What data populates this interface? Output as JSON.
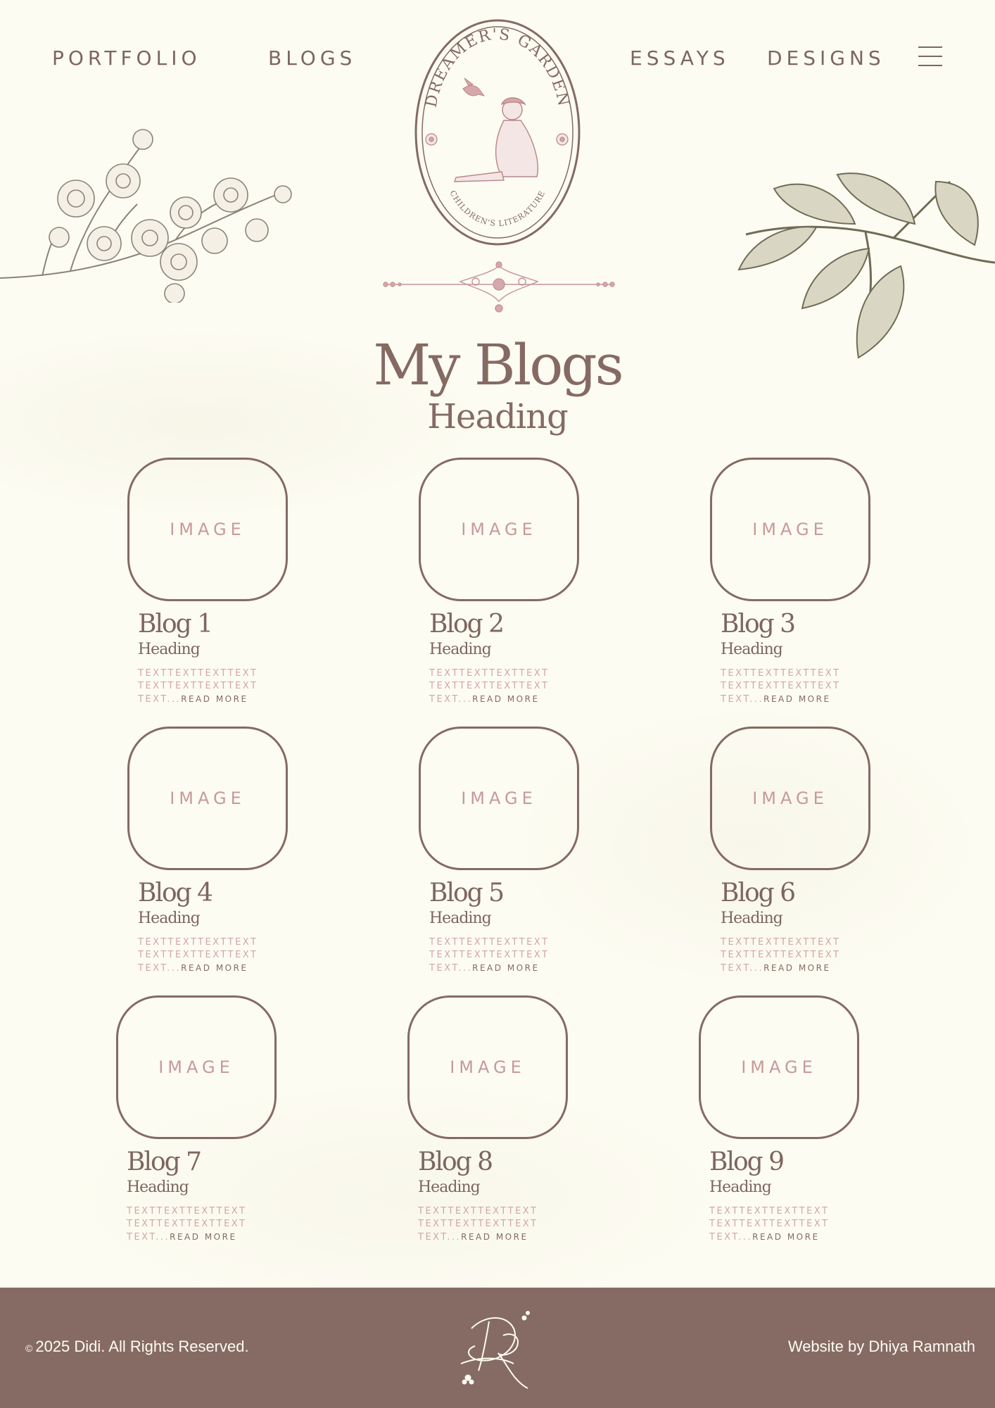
{
  "nav": {
    "portfolio": "PORTFOLIO",
    "blogs": "BLOGS",
    "essays": "ESSAYS",
    "designs": "DESIGNS",
    "menu_icon": "hamburger-menu-icon"
  },
  "logo": {
    "top_text": "DREAMER'S GARDEN",
    "bottom_text": "CHILDREN'S LITERATURE"
  },
  "page": {
    "title": "My Blogs",
    "subtitle": "Heading"
  },
  "cards": [
    {
      "image": "IMAGE",
      "title": "Blog 1",
      "heading": "Heading",
      "text": "TEXTTEXTTEXTTEXT TEXTTEXTTEXTTEXT TEXT...",
      "read_more": "READ MORE"
    },
    {
      "image": "IMAGE",
      "title": "Blog 2",
      "heading": "Heading",
      "text": "TEXTTEXTTEXTTEXT TEXTTEXTTEXTTEXT TEXT...",
      "read_more": "READ MORE"
    },
    {
      "image": "IMAGE",
      "title": "Blog 3",
      "heading": "Heading",
      "text": "TEXTTEXTTEXTTEXT TEXTTEXTTEXTTEXT TEXT...",
      "read_more": "READ MORE"
    },
    {
      "image": "IMAGE",
      "title": "Blog 4",
      "heading": "Heading",
      "text": "TEXTTEXTTEXTTEXT TEXTTEXTTEXTTEXT TEXT...",
      "read_more": "READ MORE"
    },
    {
      "image": "IMAGE",
      "title": "Blog 5",
      "heading": "Heading",
      "text": "TEXTTEXTTEXTTEXT TEXTTEXTTEXTTEXT TEXT...",
      "read_more": "READ MORE"
    },
    {
      "image": "IMAGE",
      "title": "Blog 6",
      "heading": "Heading",
      "text": "TEXTTEXTTEXTTEXT TEXTTEXTTEXTTEXT TEXT...",
      "read_more": "READ MORE"
    },
    {
      "image": "IMAGE",
      "title": "Blog 7",
      "heading": "Heading",
      "text": "TEXTTEXTTEXTTEXT TEXTTEXTTEXTTEXT TEXT...",
      "read_more": "READ MORE"
    },
    {
      "image": "IMAGE",
      "title": "Blog 8",
      "heading": "Heading",
      "text": "TEXTTEXTTEXTTEXT TEXTTEXTTEXTTEXT TEXT...",
      "read_more": "READ MORE"
    },
    {
      "image": "IMAGE",
      "title": "Blog 9",
      "heading": "Heading",
      "text": "TEXTTEXTTEXTTEXT TEXTTEXTTEXTTEXT TEXT...",
      "read_more": "READ MORE"
    }
  ],
  "footer": {
    "copyright_symbol": "©",
    "copyright": "2025 Didi. All Rights Reserved.",
    "credit": "Website by Dhiya Ramnath",
    "monogram": "DR"
  },
  "colors": {
    "background": "#fdfcf2",
    "brown": "#856a64",
    "pink": "#c79a99",
    "footer": "#866b64"
  }
}
